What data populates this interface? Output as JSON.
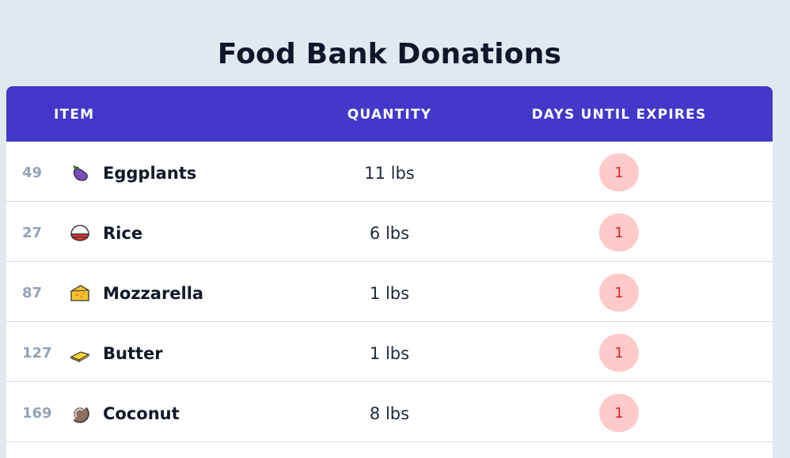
{
  "page": {
    "title": "Food Bank Donations"
  },
  "table": {
    "headers": {
      "item": "ITEM",
      "quantity": "QUANTITY",
      "days": "DAYS UNTIL EXPIRES"
    },
    "rows": [
      {
        "id": "49",
        "icon": "eggplant-icon",
        "name": "Eggplants",
        "quantity": "11 lbs",
        "days": "1"
      },
      {
        "id": "27",
        "icon": "rice-icon",
        "name": "Rice",
        "quantity": "6 lbs",
        "days": "1"
      },
      {
        "id": "87",
        "icon": "cheese-icon",
        "name": "Mozzarella",
        "quantity": "1 lbs",
        "days": "1"
      },
      {
        "id": "127",
        "icon": "butter-icon",
        "name": "Butter",
        "quantity": "1 lbs",
        "days": "1"
      },
      {
        "id": "169",
        "icon": "coconut-icon",
        "name": "Coconut",
        "quantity": "8 lbs",
        "days": "1"
      }
    ]
  },
  "colors": {
    "background": "#e2e8f0",
    "header": "#4338ca",
    "badge_bg": "#fecaca",
    "badge_text": "#dc2626"
  }
}
